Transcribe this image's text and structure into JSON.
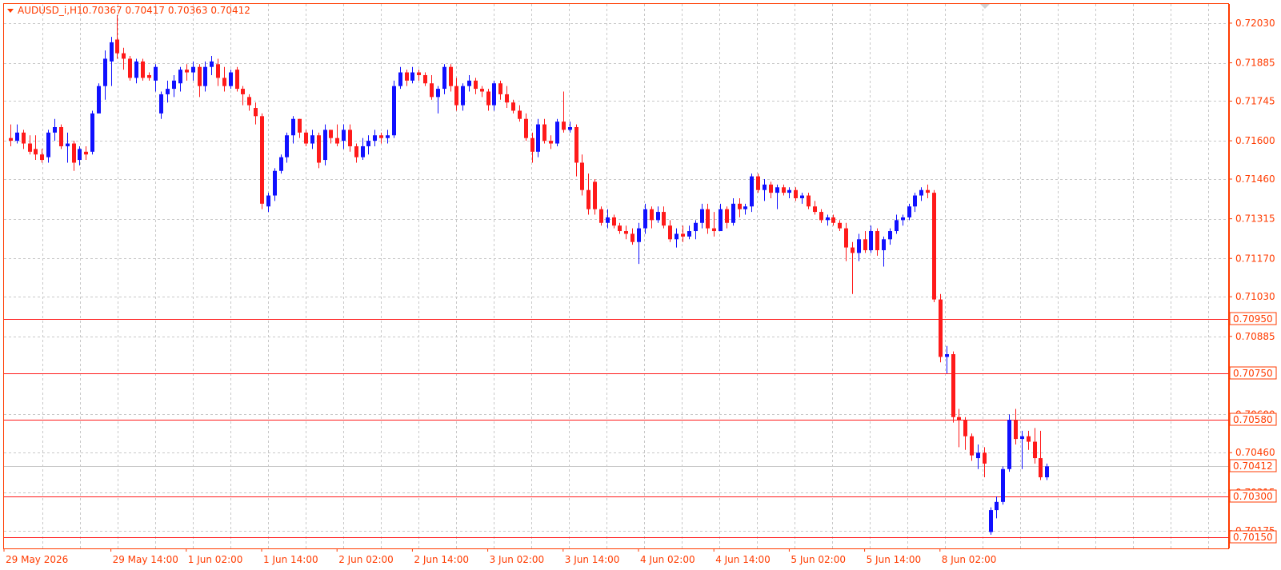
{
  "header": {
    "symbol": "AUDUSD_i,H1",
    "ohlc": "0.70367 0.70417 0.70363 0.70412"
  },
  "colors": {
    "bull": "#1010ff",
    "bear": "#ff1a1a",
    "accent": "#ff3b00",
    "grid": "#c8c8c8",
    "level_line": "#ff1a1a",
    "current_line": "#c8c8c8"
  },
  "chart_data": {
    "type": "candlestick",
    "price_axis": {
      "range": [
        0.7011,
        0.721
      ],
      "ticks": [
        "0.72030",
        "0.71885",
        "0.71745",
        "0.71600",
        "0.71460",
        "0.71315",
        "0.71170",
        "0.71030",
        "0.70885",
        "0.70600",
        "0.70460",
        "0.70315",
        "0.70175"
      ],
      "tick_values": [
        0.7203,
        0.71885,
        0.71745,
        0.716,
        0.7146,
        0.71315,
        0.7117,
        0.7103,
        0.70885,
        0.706,
        0.7046,
        0.70315,
        0.70175
      ],
      "position": "right"
    },
    "time_axis": {
      "labels": [
        "29 May 2026",
        "29 May 14:00",
        "1 Jun 02:00",
        "1 Jun 14:00",
        "2 Jun 02:00",
        "2 Jun 14:00",
        "3 Jun 02:00",
        "3 Jun 14:00",
        "4 Jun 02:00",
        "4 Jun 14:00",
        "5 Jun 02:00",
        "5 Jun 14:00",
        "8 Jun 02:00"
      ],
      "label_bar_index": [
        0,
        16,
        28,
        40,
        52,
        64,
        76,
        88,
        100,
        112,
        124,
        136,
        148
      ]
    },
    "levels": [
      {
        "price": 0.7095,
        "label": "0.70950"
      },
      {
        "price": 0.7075,
        "label": "0.70750"
      },
      {
        "price": 0.7058,
        "label": "0.70580"
      },
      {
        "price": 0.703,
        "label": "0.70300"
      },
      {
        "price": 0.7015,
        "label": "0.70150"
      }
    ],
    "current_price": {
      "price": 0.70412,
      "label": "0.70412"
    },
    "grid": true,
    "candles": [
      {
        "o": 0.7161,
        "h": 0.7166,
        "l": 0.7158,
        "c": 0.716
      },
      {
        "o": 0.716,
        "h": 0.7166,
        "l": 0.7159,
        "c": 0.7163
      },
      {
        "o": 0.7163,
        "h": 0.7164,
        "l": 0.7157,
        "c": 0.7159
      },
      {
        "o": 0.7159,
        "h": 0.7162,
        "l": 0.7155,
        "c": 0.7156
      },
      {
        "o": 0.7157,
        "h": 0.7162,
        "l": 0.7153,
        "c": 0.7155
      },
      {
        "o": 0.7155,
        "h": 0.7157,
        "l": 0.7152,
        "c": 0.7153
      },
      {
        "o": 0.7154,
        "h": 0.7164,
        "l": 0.7152,
        "c": 0.7163
      },
      {
        "o": 0.7163,
        "h": 0.7168,
        "l": 0.716,
        "c": 0.7165
      },
      {
        "o": 0.7165,
        "h": 0.7166,
        "l": 0.7157,
        "c": 0.7158
      },
      {
        "o": 0.7158,
        "h": 0.7163,
        "l": 0.7152,
        "c": 0.7159
      },
      {
        "o": 0.7159,
        "h": 0.716,
        "l": 0.7149,
        "c": 0.7152
      },
      {
        "o": 0.7153,
        "h": 0.7158,
        "l": 0.7151,
        "c": 0.7157
      },
      {
        "o": 0.7156,
        "h": 0.7158,
        "l": 0.7153,
        "c": 0.7155
      },
      {
        "o": 0.7156,
        "h": 0.7171,
        "l": 0.7155,
        "c": 0.717
      },
      {
        "o": 0.717,
        "h": 0.7181,
        "l": 0.717,
        "c": 0.718
      },
      {
        "o": 0.718,
        "h": 0.7193,
        "l": 0.7175,
        "c": 0.719
      },
      {
        "o": 0.7189,
        "h": 0.7198,
        "l": 0.718,
        "c": 0.7196
      },
      {
        "o": 0.7197,
        "h": 0.7206,
        "l": 0.719,
        "c": 0.7192
      },
      {
        "o": 0.7192,
        "h": 0.7194,
        "l": 0.7186,
        "c": 0.719
      },
      {
        "o": 0.719,
        "h": 0.7191,
        "l": 0.7182,
        "c": 0.7183
      },
      {
        "o": 0.7183,
        "h": 0.719,
        "l": 0.7181,
        "c": 0.7189
      },
      {
        "o": 0.7189,
        "h": 0.719,
        "l": 0.7182,
        "c": 0.7183
      },
      {
        "o": 0.7184,
        "h": 0.7185,
        "l": 0.7182,
        "c": 0.7183
      },
      {
        "o": 0.7182,
        "h": 0.7188,
        "l": 0.7178,
        "c": 0.7187
      },
      {
        "o": 0.717,
        "h": 0.7178,
        "l": 0.7168,
        "c": 0.7177
      },
      {
        "o": 0.7177,
        "h": 0.7182,
        "l": 0.7174,
        "c": 0.7179
      },
      {
        "o": 0.7179,
        "h": 0.7184,
        "l": 0.7176,
        "c": 0.7182
      },
      {
        "o": 0.7181,
        "h": 0.7187,
        "l": 0.7178,
        "c": 0.7186
      },
      {
        "o": 0.7186,
        "h": 0.7188,
        "l": 0.7182,
        "c": 0.7185
      },
      {
        "o": 0.7185,
        "h": 0.7189,
        "l": 0.7182,
        "c": 0.7187
      },
      {
        "o": 0.7187,
        "h": 0.7188,
        "l": 0.7176,
        "c": 0.718
      },
      {
        "o": 0.718,
        "h": 0.7189,
        "l": 0.7178,
        "c": 0.7187
      },
      {
        "o": 0.7187,
        "h": 0.7191,
        "l": 0.7184,
        "c": 0.7189
      },
      {
        "o": 0.7188,
        "h": 0.719,
        "l": 0.718,
        "c": 0.7183
      },
      {
        "o": 0.7183,
        "h": 0.7187,
        "l": 0.7178,
        "c": 0.718
      },
      {
        "o": 0.718,
        "h": 0.7186,
        "l": 0.7179,
        "c": 0.7185
      },
      {
        "o": 0.7186,
        "h": 0.7187,
        "l": 0.7178,
        "c": 0.7179
      },
      {
        "o": 0.7179,
        "h": 0.718,
        "l": 0.7173,
        "c": 0.7177
      },
      {
        "o": 0.7176,
        "h": 0.7177,
        "l": 0.7171,
        "c": 0.7173
      },
      {
        "o": 0.7172,
        "h": 0.7174,
        "l": 0.7166,
        "c": 0.7169
      },
      {
        "o": 0.7169,
        "h": 0.717,
        "l": 0.7135,
        "c": 0.7137
      },
      {
        "o": 0.7136,
        "h": 0.7141,
        "l": 0.7134,
        "c": 0.714
      },
      {
        "o": 0.714,
        "h": 0.715,
        "l": 0.7138,
        "c": 0.7149
      },
      {
        "o": 0.7149,
        "h": 0.7155,
        "l": 0.7148,
        "c": 0.7154
      },
      {
        "o": 0.7154,
        "h": 0.7163,
        "l": 0.7152,
        "c": 0.7162
      },
      {
        "o": 0.7162,
        "h": 0.7169,
        "l": 0.7159,
        "c": 0.7168
      },
      {
        "o": 0.7168,
        "h": 0.7168,
        "l": 0.7161,
        "c": 0.7163
      },
      {
        "o": 0.7163,
        "h": 0.7164,
        "l": 0.7158,
        "c": 0.7159
      },
      {
        "o": 0.7159,
        "h": 0.7164,
        "l": 0.7157,
        "c": 0.7162
      },
      {
        "o": 0.7162,
        "h": 0.7163,
        "l": 0.715,
        "c": 0.7152
      },
      {
        "o": 0.7153,
        "h": 0.7166,
        "l": 0.7151,
        "c": 0.7164
      },
      {
        "o": 0.7164,
        "h": 0.7164,
        "l": 0.7159,
        "c": 0.7161
      },
      {
        "o": 0.7161,
        "h": 0.7166,
        "l": 0.7158,
        "c": 0.7159
      },
      {
        "o": 0.716,
        "h": 0.7166,
        "l": 0.7157,
        "c": 0.7164
      },
      {
        "o": 0.7164,
        "h": 0.7166,
        "l": 0.7156,
        "c": 0.7158
      },
      {
        "o": 0.7158,
        "h": 0.7159,
        "l": 0.7152,
        "c": 0.7154
      },
      {
        "o": 0.7154,
        "h": 0.7161,
        "l": 0.7153,
        "c": 0.7158
      },
      {
        "o": 0.7158,
        "h": 0.7162,
        "l": 0.7155,
        "c": 0.716
      },
      {
        "o": 0.716,
        "h": 0.7164,
        "l": 0.7158,
        "c": 0.7162
      },
      {
        "o": 0.7162,
        "h": 0.7163,
        "l": 0.7159,
        "c": 0.7161
      },
      {
        "o": 0.7161,
        "h": 0.7164,
        "l": 0.7159,
        "c": 0.7162
      },
      {
        "o": 0.7162,
        "h": 0.7182,
        "l": 0.7161,
        "c": 0.718
      },
      {
        "o": 0.718,
        "h": 0.7187,
        "l": 0.7179,
        "c": 0.7185
      },
      {
        "o": 0.7185,
        "h": 0.7186,
        "l": 0.718,
        "c": 0.7182
      },
      {
        "o": 0.7182,
        "h": 0.7187,
        "l": 0.7181,
        "c": 0.7185
      },
      {
        "o": 0.7185,
        "h": 0.7186,
        "l": 0.7182,
        "c": 0.7184
      },
      {
        "o": 0.7184,
        "h": 0.7185,
        "l": 0.718,
        "c": 0.7181
      },
      {
        "o": 0.7181,
        "h": 0.7184,
        "l": 0.7175,
        "c": 0.7176
      },
      {
        "o": 0.7176,
        "h": 0.718,
        "l": 0.717,
        "c": 0.7179
      },
      {
        "o": 0.7179,
        "h": 0.7188,
        "l": 0.7177,
        "c": 0.7187
      },
      {
        "o": 0.7187,
        "h": 0.7188,
        "l": 0.7178,
        "c": 0.718
      },
      {
        "o": 0.718,
        "h": 0.7183,
        "l": 0.7171,
        "c": 0.7173
      },
      {
        "o": 0.7173,
        "h": 0.7181,
        "l": 0.7171,
        "c": 0.718
      },
      {
        "o": 0.718,
        "h": 0.7184,
        "l": 0.7178,
        "c": 0.7182
      },
      {
        "o": 0.7182,
        "h": 0.7183,
        "l": 0.7177,
        "c": 0.7179
      },
      {
        "o": 0.7179,
        "h": 0.718,
        "l": 0.7176,
        "c": 0.7178
      },
      {
        "o": 0.7178,
        "h": 0.7179,
        "l": 0.7171,
        "c": 0.7173
      },
      {
        "o": 0.7173,
        "h": 0.7182,
        "l": 0.7171,
        "c": 0.7181
      },
      {
        "o": 0.7181,
        "h": 0.7182,
        "l": 0.7175,
        "c": 0.7177
      },
      {
        "o": 0.7177,
        "h": 0.718,
        "l": 0.7172,
        "c": 0.7174
      },
      {
        "o": 0.7174,
        "h": 0.7175,
        "l": 0.717,
        "c": 0.7171
      },
      {
        "o": 0.7171,
        "h": 0.7173,
        "l": 0.7167,
        "c": 0.7168
      },
      {
        "o": 0.7168,
        "h": 0.717,
        "l": 0.716,
        "c": 0.7161
      },
      {
        "o": 0.7161,
        "h": 0.7163,
        "l": 0.7152,
        "c": 0.7156
      },
      {
        "o": 0.7156,
        "h": 0.7168,
        "l": 0.7154,
        "c": 0.7166
      },
      {
        "o": 0.7166,
        "h": 0.7168,
        "l": 0.7159,
        "c": 0.716
      },
      {
        "o": 0.716,
        "h": 0.7162,
        "l": 0.7157,
        "c": 0.7159
      },
      {
        "o": 0.7159,
        "h": 0.7168,
        "l": 0.7158,
        "c": 0.7167
      },
      {
        "o": 0.7167,
        "h": 0.7178,
        "l": 0.7163,
        "c": 0.7164
      },
      {
        "o": 0.7164,
        "h": 0.7167,
        "l": 0.7163,
        "c": 0.7165
      },
      {
        "o": 0.7165,
        "h": 0.7166,
        "l": 0.7147,
        "c": 0.7152
      },
      {
        "o": 0.7152,
        "h": 0.7155,
        "l": 0.714,
        "c": 0.7142
      },
      {
        "o": 0.7142,
        "h": 0.7148,
        "l": 0.7133,
        "c": 0.7135
      },
      {
        "o": 0.7145,
        "h": 0.7146,
        "l": 0.7133,
        "c": 0.7135
      },
      {
        "o": 0.7135,
        "h": 0.7136,
        "l": 0.7129,
        "c": 0.713
      },
      {
        "o": 0.713,
        "h": 0.7135,
        "l": 0.7128,
        "c": 0.7132
      },
      {
        "o": 0.7132,
        "h": 0.7133,
        "l": 0.7128,
        "c": 0.7129
      },
      {
        "o": 0.7129,
        "h": 0.713,
        "l": 0.7126,
        "c": 0.7127
      },
      {
        "o": 0.7127,
        "h": 0.7129,
        "l": 0.7124,
        "c": 0.7126
      },
      {
        "o": 0.7126,
        "h": 0.7128,
        "l": 0.7122,
        "c": 0.7123
      },
      {
        "o": 0.7123,
        "h": 0.713,
        "l": 0.7115,
        "c": 0.7128
      },
      {
        "o": 0.7128,
        "h": 0.7137,
        "l": 0.7126,
        "c": 0.7135
      },
      {
        "o": 0.7135,
        "h": 0.7136,
        "l": 0.7128,
        "c": 0.7131
      },
      {
        "o": 0.7131,
        "h": 0.7136,
        "l": 0.713,
        "c": 0.7134
      },
      {
        "o": 0.7134,
        "h": 0.7136,
        "l": 0.7128,
        "c": 0.7129
      },
      {
        "o": 0.7129,
        "h": 0.7131,
        "l": 0.7123,
        "c": 0.7124
      },
      {
        "o": 0.7124,
        "h": 0.7128,
        "l": 0.7121,
        "c": 0.7126
      },
      {
        "o": 0.7126,
        "h": 0.7129,
        "l": 0.7123,
        "c": 0.7125
      },
      {
        "o": 0.7125,
        "h": 0.7129,
        "l": 0.7124,
        "c": 0.7127
      },
      {
        "o": 0.7127,
        "h": 0.7131,
        "l": 0.7124,
        "c": 0.713
      },
      {
        "o": 0.713,
        "h": 0.7137,
        "l": 0.7128,
        "c": 0.7135
      },
      {
        "o": 0.7135,
        "h": 0.7137,
        "l": 0.7126,
        "c": 0.7128
      },
      {
        "o": 0.7128,
        "h": 0.7134,
        "l": 0.7125,
        "c": 0.7127
      },
      {
        "o": 0.7127,
        "h": 0.7137,
        "l": 0.7127,
        "c": 0.7135
      },
      {
        "o": 0.7135,
        "h": 0.7136,
        "l": 0.7128,
        "c": 0.713
      },
      {
        "o": 0.713,
        "h": 0.7139,
        "l": 0.7129,
        "c": 0.7137
      },
      {
        "o": 0.7137,
        "h": 0.7139,
        "l": 0.7132,
        "c": 0.7135
      },
      {
        "o": 0.7135,
        "h": 0.7137,
        "l": 0.7133,
        "c": 0.7136
      },
      {
        "o": 0.7136,
        "h": 0.7148,
        "l": 0.7134,
        "c": 0.7147
      },
      {
        "o": 0.7147,
        "h": 0.7148,
        "l": 0.7141,
        "c": 0.7142
      },
      {
        "o": 0.7142,
        "h": 0.7146,
        "l": 0.7138,
        "c": 0.7144
      },
      {
        "o": 0.7144,
        "h": 0.7145,
        "l": 0.7139,
        "c": 0.7141
      },
      {
        "o": 0.7141,
        "h": 0.7144,
        "l": 0.7135,
        "c": 0.7143
      },
      {
        "o": 0.7143,
        "h": 0.7144,
        "l": 0.714,
        "c": 0.7141
      },
      {
        "o": 0.7141,
        "h": 0.7143,
        "l": 0.7139,
        "c": 0.7142
      },
      {
        "o": 0.7142,
        "h": 0.7143,
        "l": 0.7138,
        "c": 0.7139
      },
      {
        "o": 0.7139,
        "h": 0.7141,
        "l": 0.7137,
        "c": 0.714
      },
      {
        "o": 0.714,
        "h": 0.7141,
        "l": 0.7135,
        "c": 0.7136
      },
      {
        "o": 0.7136,
        "h": 0.7138,
        "l": 0.7133,
        "c": 0.7134
      },
      {
        "o": 0.7134,
        "h": 0.7135,
        "l": 0.713,
        "c": 0.7131
      },
      {
        "o": 0.7131,
        "h": 0.7133,
        "l": 0.7129,
        "c": 0.7132
      },
      {
        "o": 0.7132,
        "h": 0.7133,
        "l": 0.7129,
        "c": 0.713
      },
      {
        "o": 0.713,
        "h": 0.7131,
        "l": 0.7127,
        "c": 0.7128
      },
      {
        "o": 0.7128,
        "h": 0.713,
        "l": 0.7116,
        "c": 0.7121
      },
      {
        "o": 0.7121,
        "h": 0.7123,
        "l": 0.7104,
        "c": 0.7119
      },
      {
        "o": 0.7119,
        "h": 0.7126,
        "l": 0.7116,
        "c": 0.7124
      },
      {
        "o": 0.7124,
        "h": 0.7127,
        "l": 0.7119,
        "c": 0.712
      },
      {
        "o": 0.712,
        "h": 0.7129,
        "l": 0.7119,
        "c": 0.7127
      },
      {
        "o": 0.7127,
        "h": 0.7128,
        "l": 0.7118,
        "c": 0.712
      },
      {
        "o": 0.712,
        "h": 0.7125,
        "l": 0.7114,
        "c": 0.7124
      },
      {
        "o": 0.7124,
        "h": 0.7128,
        "l": 0.7122,
        "c": 0.7127
      },
      {
        "o": 0.7127,
        "h": 0.7133,
        "l": 0.7126,
        "c": 0.7131
      },
      {
        "o": 0.7131,
        "h": 0.7133,
        "l": 0.7129,
        "c": 0.7132
      },
      {
        "o": 0.7132,
        "h": 0.7137,
        "l": 0.7131,
        "c": 0.7136
      },
      {
        "o": 0.7136,
        "h": 0.7141,
        "l": 0.7134,
        "c": 0.714
      },
      {
        "o": 0.714,
        "h": 0.7143,
        "l": 0.7138,
        "c": 0.7142
      },
      {
        "o": 0.7142,
        "h": 0.7144,
        "l": 0.7139,
        "c": 0.7141
      },
      {
        "o": 0.7141,
        "h": 0.7142,
        "l": 0.7101,
        "c": 0.7102
      },
      {
        "o": 0.7102,
        "h": 0.7104,
        "l": 0.7079,
        "c": 0.7081
      },
      {
        "o": 0.7081,
        "h": 0.7085,
        "l": 0.7075,
        "c": 0.7082
      },
      {
        "o": 0.7082,
        "h": 0.7083,
        "l": 0.7057,
        "c": 0.7059
      },
      {
        "o": 0.7059,
        "h": 0.7062,
        "l": 0.7048,
        "c": 0.7058
      },
      {
        "o": 0.7058,
        "h": 0.7059,
        "l": 0.7047,
        "c": 0.7052
      },
      {
        "o": 0.7052,
        "h": 0.7053,
        "l": 0.7043,
        "c": 0.7045
      },
      {
        "o": 0.7044,
        "h": 0.7049,
        "l": 0.704,
        "c": 0.7046
      },
      {
        "o": 0.7046,
        "h": 0.7048,
        "l": 0.7037,
        "c": 0.7042
      },
      {
        "o": 0.7017,
        "h": 0.7026,
        "l": 0.7016,
        "c": 0.7025
      },
      {
        "o": 0.7025,
        "h": 0.703,
        "l": 0.7022,
        "c": 0.7028
      },
      {
        "o": 0.7028,
        "h": 0.7041,
        "l": 0.7027,
        "c": 0.704
      },
      {
        "o": 0.704,
        "h": 0.706,
        "l": 0.7039,
        "c": 0.7058
      },
      {
        "o": 0.7058,
        "h": 0.7062,
        "l": 0.7049,
        "c": 0.7051
      },
      {
        "o": 0.7051,
        "h": 0.7054,
        "l": 0.704,
        "c": 0.7052
      },
      {
        "o": 0.7052,
        "h": 0.7054,
        "l": 0.7047,
        "c": 0.705
      },
      {
        "o": 0.705,
        "h": 0.7055,
        "l": 0.7042,
        "c": 0.7044
      },
      {
        "o": 0.7044,
        "h": 0.7054,
        "l": 0.7036,
        "c": 0.7037
      },
      {
        "o": 0.7037,
        "h": 0.7042,
        "l": 0.7036,
        "c": 0.7041
      }
    ]
  }
}
